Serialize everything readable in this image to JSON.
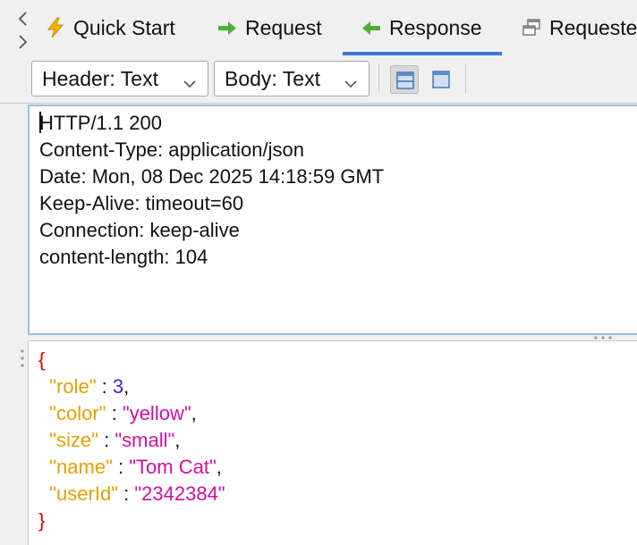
{
  "tabs": [
    {
      "label": "Quick Start",
      "icon": "lightning-icon",
      "active": false
    },
    {
      "label": "Request",
      "icon": "arrow-right-icon",
      "active": false
    },
    {
      "label": "Response",
      "icon": "arrow-left-icon",
      "active": true
    },
    {
      "label": "Requeste",
      "icon": "windows-icon",
      "active": false
    }
  ],
  "toolbar": {
    "header_select": "Header: Text",
    "body_select": "Body: Text"
  },
  "response": {
    "header_lines": [
      "HTTP/1.1 200",
      "Content-Type: application/json",
      "Date: Mon, 08 Dec 2025 14:18:59 GMT",
      "Keep-Alive: timeout=60",
      "Connection: keep-alive",
      "content-length: 104"
    ],
    "body": {
      "open_brace": "{",
      "close_brace": "}",
      "fields": [
        {
          "key": "\"role\"",
          "sep": " : ",
          "value": "3",
          "type": "num",
          "comma": ","
        },
        {
          "key": "\"color\"",
          "sep": " : ",
          "value": "\"yellow\"",
          "type": "str",
          "comma": ","
        },
        {
          "key": "\"size\"",
          "sep": " : ",
          "value": "\"small\"",
          "type": "str",
          "comma": ","
        },
        {
          "key": "\"name\"",
          "sep": " : ",
          "value": "\"Tom Cat\"",
          "type": "str",
          "comma": ","
        },
        {
          "key": "\"userId\"",
          "sep": " : ",
          "value": "\"2342384\"",
          "type": "str",
          "comma": ""
        }
      ]
    }
  },
  "colors": {
    "active_tab_underline": "#3a78d4",
    "json_brace": "#e00000",
    "json_key": "#e6a000",
    "json_number": "#4a1ec8",
    "json_string": "#d10fa2",
    "focus_border": "#9bbde0"
  }
}
